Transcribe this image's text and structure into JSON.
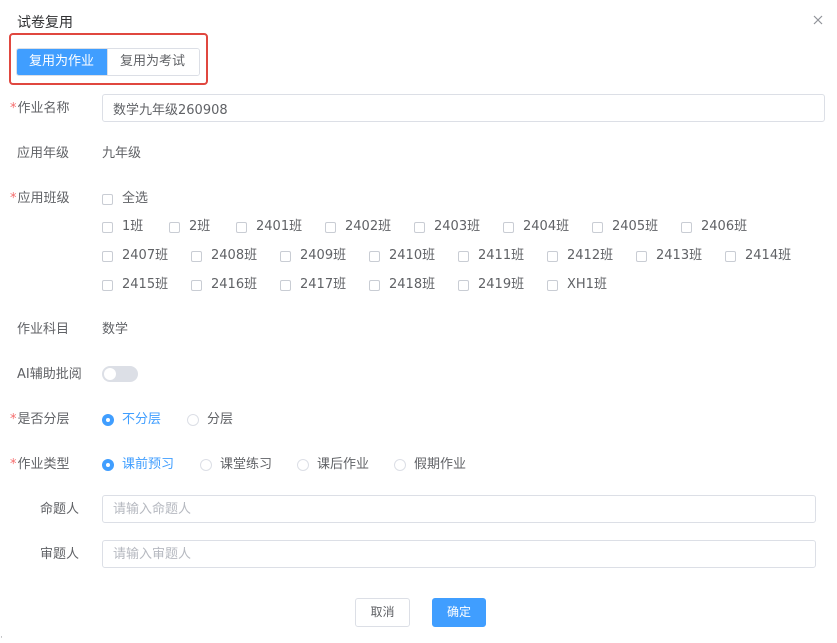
{
  "dialog": {
    "title": "试卷复用",
    "close_icon": "close-icon"
  },
  "mode_tabs": [
    {
      "label": "复用为作业",
      "active": true
    },
    {
      "label": "复用为考试",
      "active": false
    }
  ],
  "colors": {
    "primary": "#409eff",
    "required": "#f56c6c",
    "highlight_box": "#e0473f",
    "text": "#606266",
    "placeholder": "#b6b9c0"
  },
  "form": {
    "homework_name": {
      "label": "作业名称",
      "required": true,
      "value": "数学九年级260908"
    },
    "grade": {
      "label": "应用年级",
      "value": "九年级"
    },
    "classes": {
      "label": "应用班级",
      "required": true,
      "select_all": "全选",
      "options": [
        "1班",
        "2班",
        "2401班",
        "2402班",
        "2403班",
        "2404班",
        "2405班",
        "2406班",
        "2407班",
        "2408班",
        "2409班",
        "2410班",
        "2411班",
        "2412班",
        "2413班",
        "2414班",
        "2415班",
        "2416班",
        "2417班",
        "2418班",
        "2419班",
        "XH1班"
      ]
    },
    "subject": {
      "label": "作业科目",
      "value": "数学"
    },
    "ai_review": {
      "label": "AI辅助批阅",
      "enabled": false
    },
    "layered": {
      "label": "是否分层",
      "required": true,
      "options": [
        {
          "label": "不分层",
          "checked": true
        },
        {
          "label": "分层",
          "checked": false
        }
      ]
    },
    "homework_type": {
      "label": "作业类型",
      "required": true,
      "options": [
        {
          "label": "课前预习",
          "checked": true
        },
        {
          "label": "课堂练习",
          "checked": false
        },
        {
          "label": "课后作业",
          "checked": false
        },
        {
          "label": "假期作业",
          "checked": false
        }
      ]
    },
    "author": {
      "label": "命题人",
      "value": "",
      "placeholder": "请输入命题人"
    },
    "reviewer": {
      "label": "审题人",
      "value": "",
      "placeholder": "请输入审题人"
    }
  },
  "footer": {
    "cancel_label": "取消",
    "confirm_label": "确定"
  },
  "corner_mark": "·"
}
